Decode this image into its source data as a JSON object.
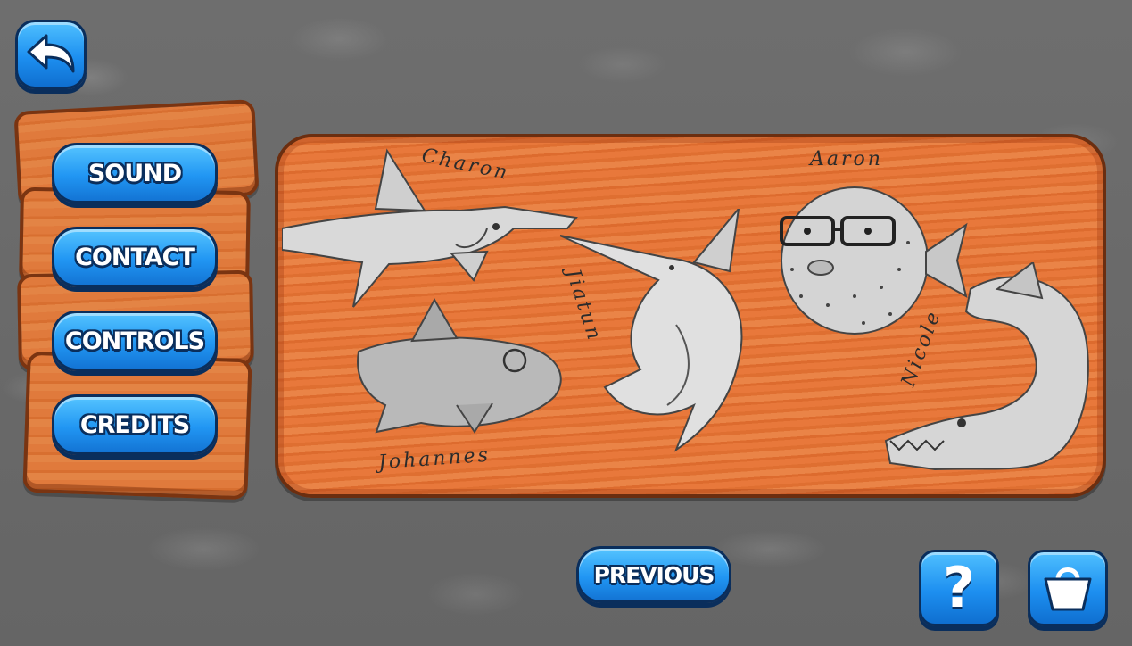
{
  "menu": {
    "sound_label": "SOUND",
    "contact_label": "CONTACT",
    "controls_label": "CONTROLS",
    "credits_label": "CREDITS"
  },
  "credits_panel": {
    "names": {
      "shark": "Charon",
      "puffer": "Aaron",
      "marlin": "Jiatun",
      "eel": "Nicole",
      "dolphin": "Johannes"
    }
  },
  "nav": {
    "previous_label": "PREVIOUS",
    "help_glyph": "?"
  },
  "icons": {
    "back": "back-arrow-icon",
    "help": "question-mark-icon",
    "shop": "shopping-bag-icon"
  },
  "colors": {
    "button_blue": "#2196f3",
    "button_outline": "#0a2e5c",
    "wood_orange": "#e07a3c",
    "wood_border": "#7a3411",
    "background_stone": "#6b6b6b"
  }
}
